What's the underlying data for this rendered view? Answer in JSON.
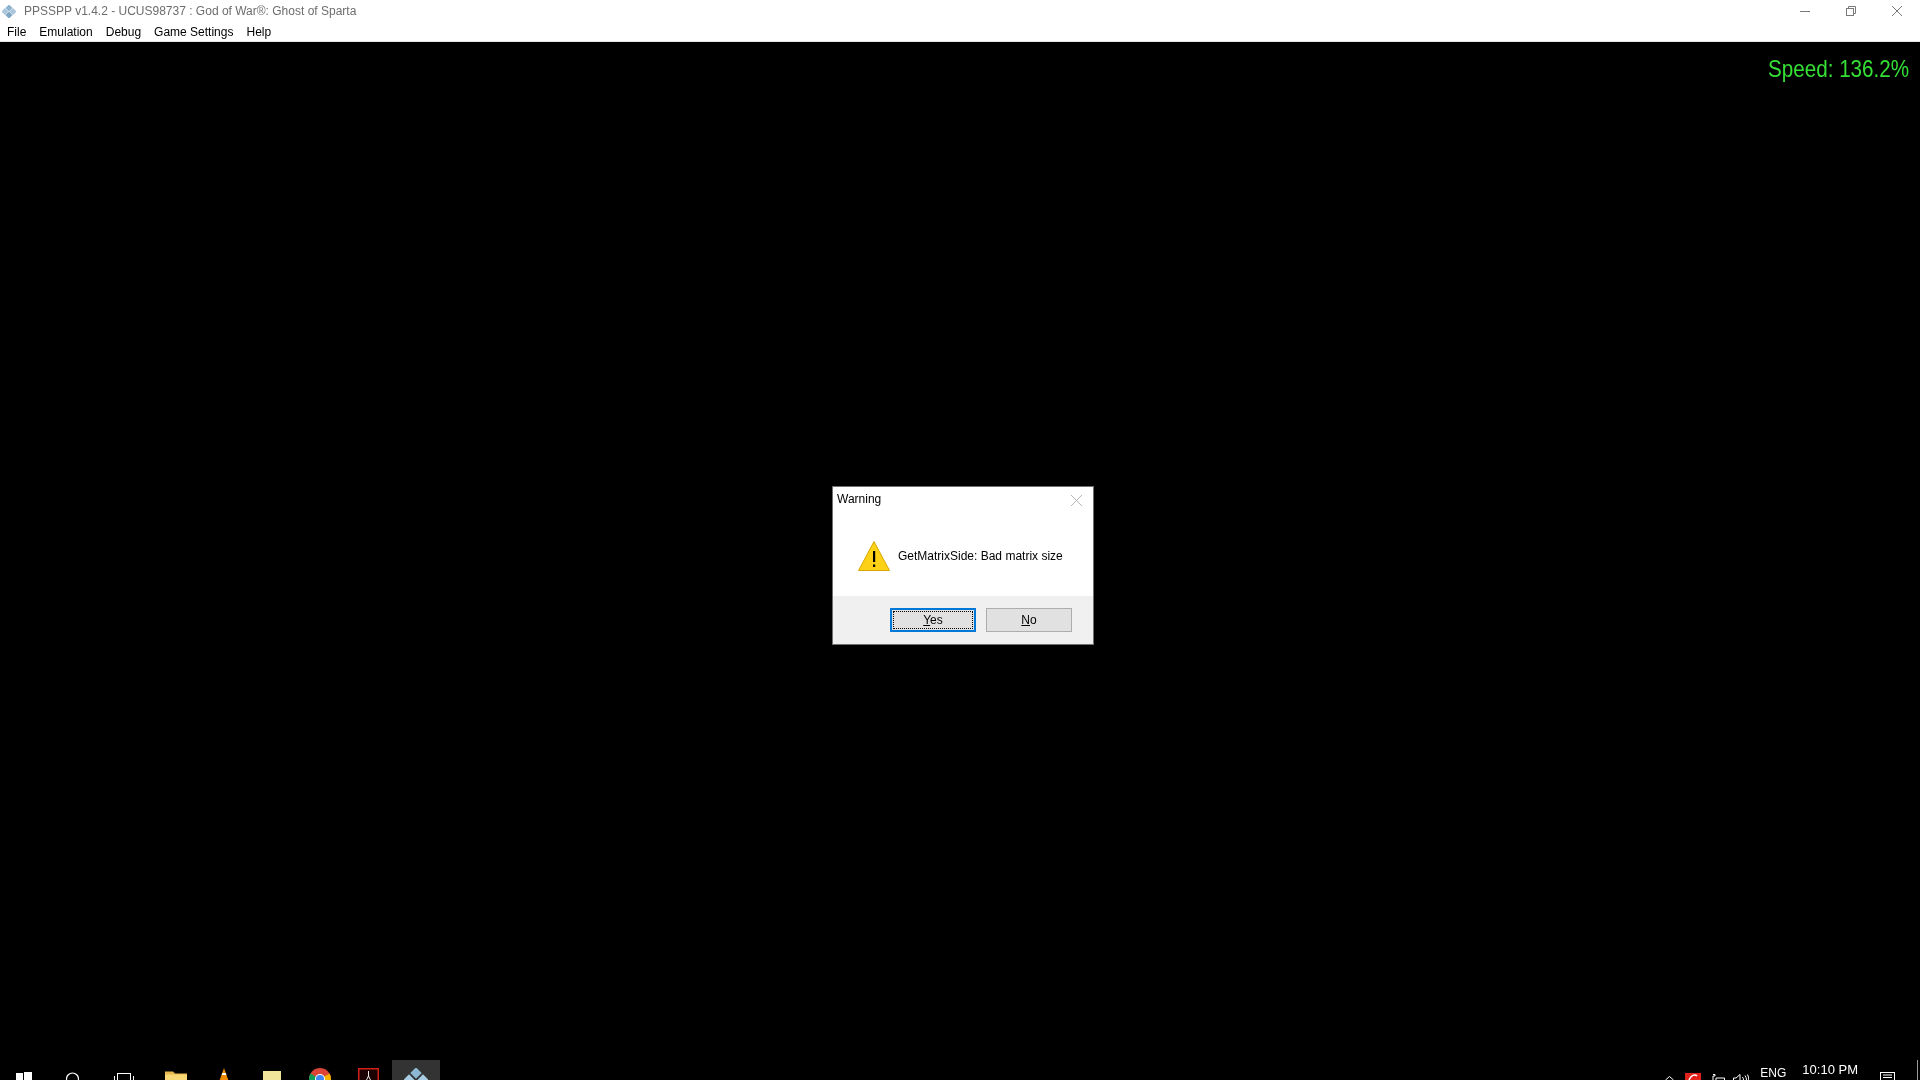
{
  "window": {
    "title": "PPSSPP v1.4.2 - UCUS98737 : God of War®: Ghost of Sparta",
    "active": false
  },
  "menu": [
    "File",
    "Emulation",
    "Debug",
    "Game Settings",
    "Help"
  ],
  "speed_overlay": {
    "text": "Speed: 136.2%"
  },
  "dialog": {
    "title": "Warning",
    "close": {
      "disabled": true
    },
    "message": "GetMatrixSide: Bad matrix size",
    "buttons": [
      {
        "label": "Yes",
        "focused": true
      },
      {
        "label": "No",
        "focused": false
      }
    ]
  },
  "taskbar": {
    "apps": [
      {
        "kind": "folder",
        "active": false
      },
      {
        "kind": "cone",
        "active": false
      },
      {
        "kind": "notes",
        "active": false
      },
      {
        "kind": "round-logo",
        "active": false
      },
      {
        "kind": "framed-tile",
        "active": false
      },
      {
        "kind": "diamond-cluster",
        "active": true
      }
    ],
    "tray": {
      "language": "ENG",
      "time": "10:10 PM"
    }
  }
}
